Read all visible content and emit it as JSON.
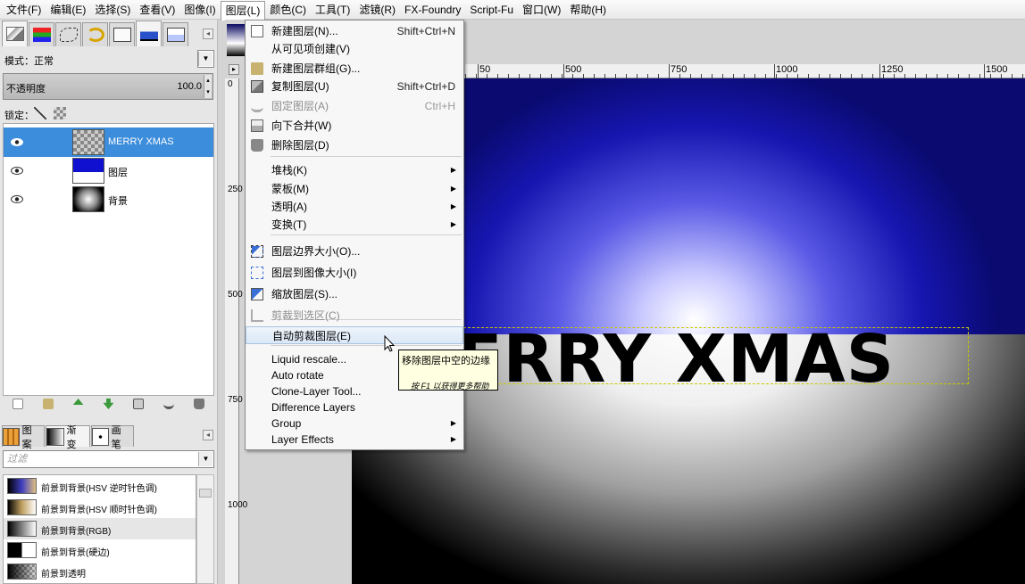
{
  "menubar": [
    "文件(F)",
    "编辑(E)",
    "选择(S)",
    "查看(V)",
    "图像(I)",
    "图层(L)",
    "颜色(C)",
    "工具(T)",
    "滤镜(R)",
    "FX-Foundry",
    "Script-Fu",
    "窗口(W)",
    "帮助(H)"
  ],
  "menubar_active": "图层(L)",
  "layers_panel": {
    "mode_label": "模式：",
    "mode_value": "正常",
    "opacity_label": "不透明度",
    "opacity_value": "100.0",
    "lock_label": "锁定：",
    "layers": [
      {
        "name": "MERRY XMAS",
        "selected": true,
        "thumb": "checker"
      },
      {
        "name": "图层",
        "selected": false,
        "thumb": "blue-white"
      },
      {
        "name": "背景",
        "selected": false,
        "thumb": "radial"
      }
    ]
  },
  "gradients_panel": {
    "tabs": [
      "图案",
      "渐变",
      "画笔"
    ],
    "filter_placeholder": "过滤",
    "items": [
      {
        "label": "前景到背景(HSV 逆时针色调)"
      },
      {
        "label": "前景到背景(HSV 顺时针色调)"
      },
      {
        "label": "前景到背景(RGB)"
      },
      {
        "label": "前景到背景(硬边)"
      },
      {
        "label": "前景到透明"
      }
    ]
  },
  "ruler": {
    "h_labels": [
      "50",
      "500",
      "750",
      "1000",
      "1250",
      "1500"
    ],
    "v_labels": [
      "0",
      "250",
      "500",
      "750",
      "1000"
    ]
  },
  "canvas": {
    "text": "MERRY XMAS",
    "visible_text": "ERRY XMAS"
  },
  "layer_menu": {
    "items": [
      {
        "label": "新建图层(N)...",
        "shortcut": "Shift+Ctrl+N",
        "icon": "new-layer-icon"
      },
      {
        "label": "从可见项创建(V)",
        "shortcut": ""
      },
      {
        "label": "新建图层群组(G)...",
        "shortcut": "",
        "icon": "folder-icon"
      },
      {
        "label": "复制图层(U)",
        "shortcut": "Shift+Ctrl+D",
        "icon": "duplicate-icon"
      },
      {
        "label": "固定图层(A)",
        "shortcut": "Ctrl+H",
        "icon": "anchor-icon",
        "disabled": true
      },
      {
        "label": "向下合并(W)",
        "shortcut": "",
        "icon": "merge-down-icon"
      },
      {
        "label": "删除图层(D)",
        "shortcut": "",
        "icon": "trash-icon"
      },
      {
        "label": "堆栈(K)",
        "submenu": true
      },
      {
        "label": "蒙板(M)",
        "submenu": true
      },
      {
        "label": "透明(A)",
        "submenu": true
      },
      {
        "label": "变换(T)",
        "submenu": true
      },
      {
        "label": "图层边界大小(O)...",
        "icon": "layer-boundary-icon"
      },
      {
        "label": "图层到图像大小(I)",
        "icon": "layer-to-image-icon"
      },
      {
        "label": "缩放图层(S)...",
        "icon": "scale-layer-icon"
      },
      {
        "label": "剪裁到选区(C)",
        "icon": "crop-icon",
        "disabled": true
      },
      {
        "label": "自动剪裁图层(E)",
        "highlighted": true
      },
      {
        "label": "Liquid rescale..."
      },
      {
        "label": "Auto rotate"
      },
      {
        "label": "Clone-Layer Tool..."
      },
      {
        "label": "Difference Layers"
      },
      {
        "label": "Group",
        "submenu": true
      },
      {
        "label": "Layer Effects",
        "submenu": true
      }
    ]
  },
  "tooltip": {
    "text": "移除图层中空的边缘",
    "help": "按 F1 以获得更多帮助"
  }
}
